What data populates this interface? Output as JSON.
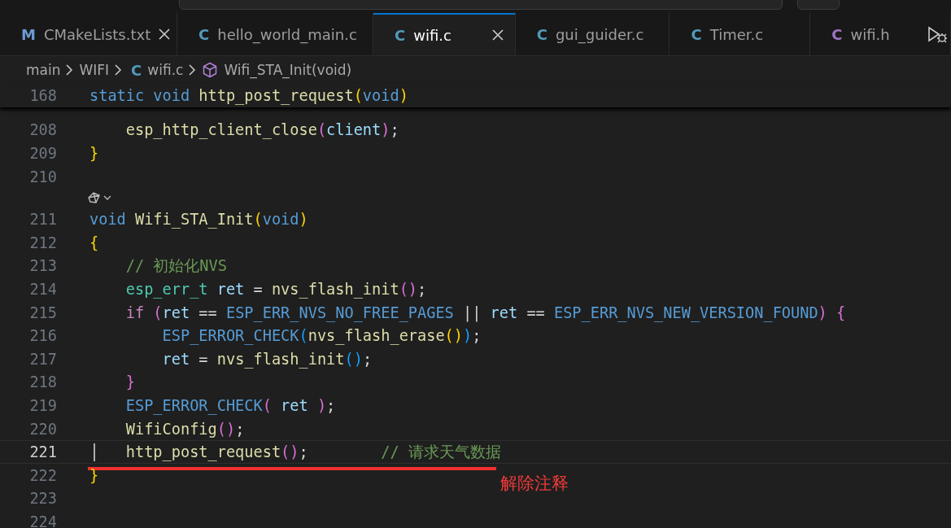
{
  "tabs": [
    {
      "icon": "M",
      "color": "#6c9bd2",
      "label": "CMakeLists.txt",
      "selected": false,
      "closable": true
    },
    {
      "icon": "C",
      "color": "#519aba",
      "label": "hello_world_main.c",
      "selected": false,
      "closable": false
    },
    {
      "icon": "C",
      "color": "#519aba",
      "label": "wifi.c",
      "selected": true,
      "closable": true
    },
    {
      "icon": "C",
      "color": "#519aba",
      "label": "gui_guider.c",
      "selected": false,
      "closable": false
    },
    {
      "icon": "C",
      "color": "#519aba",
      "label": "Timer.c",
      "selected": false,
      "closable": false
    },
    {
      "icon": "C",
      "color": "#a074c4",
      "label": "wifi.h",
      "selected": false,
      "closable": false
    }
  ],
  "breadcrumb": [
    {
      "kind": "folder",
      "label": "main"
    },
    {
      "kind": "folder",
      "label": "WIFI"
    },
    {
      "kind": "file",
      "icon": "C",
      "label": "wifi.c"
    },
    {
      "kind": "symbol",
      "label": "Wifi_STA_Init(void)"
    }
  ],
  "sticky_line": {
    "number": "168",
    "tokens": [
      {
        "color": "#569cd6",
        "t": "static void"
      },
      {
        "color": "#dcdcaa",
        "t": " http_post_request"
      },
      {
        "color": "#ffd700",
        "t": "("
      },
      {
        "color": "#569cd6",
        "t": "void"
      },
      {
        "color": "#ffd700",
        "t": ")"
      }
    ]
  },
  "lines": [
    {
      "kind": "code",
      "number": "208",
      "current": false,
      "tokens": [
        {
          "color": "#dcdcaa",
          "t": "    esp_http_client_close"
        },
        {
          "color": "#da70d6",
          "t": "("
        },
        {
          "color": "#9cdcfe",
          "t": "client"
        },
        {
          "color": "#da70d6",
          "t": ")"
        },
        {
          "color": "#d4d4d4",
          "t": ";"
        }
      ]
    },
    {
      "kind": "code",
      "number": "209",
      "current": false,
      "tokens": [
        {
          "color": "#ffd700",
          "t": "}"
        }
      ]
    },
    {
      "kind": "code",
      "number": "210",
      "current": false
    },
    {
      "kind": "lens"
    },
    {
      "kind": "code",
      "number": "211",
      "current": false,
      "tokens": [
        {
          "color": "#569cd6",
          "t": "void"
        },
        {
          "color": "#dcdcaa",
          "t": " Wifi_STA_Init"
        },
        {
          "color": "#ffd700",
          "t": "("
        },
        {
          "color": "#569cd6",
          "t": "void"
        },
        {
          "color": "#ffd700",
          "t": ")"
        }
      ]
    },
    {
      "kind": "code",
      "number": "212",
      "current": false,
      "tokens": [
        {
          "color": "#ffd700",
          "t": "{"
        }
      ]
    },
    {
      "kind": "code",
      "number": "213",
      "current": false,
      "tokens": [
        {
          "color": "#6a9955",
          "t": "    // 初始化NVS"
        }
      ]
    },
    {
      "kind": "code",
      "number": "214",
      "current": false,
      "tokens": [
        {
          "color": "#4ec9b0",
          "t": "    esp_err_t"
        },
        {
          "color": "#9cdcfe",
          "t": " ret"
        },
        {
          "color": "#d4d4d4",
          "t": " = "
        },
        {
          "color": "#dcdcaa",
          "t": "nvs_flash_init"
        },
        {
          "color": "#da70d6",
          "t": "()"
        },
        {
          "color": "#d4d4d4",
          "t": ";"
        }
      ]
    },
    {
      "kind": "code",
      "number": "215",
      "current": false,
      "tokens": [
        {
          "color": "#c586c0",
          "t": "    if"
        },
        {
          "color": "#da70d6",
          "t": " ("
        },
        {
          "color": "#9cdcfe",
          "t": "ret"
        },
        {
          "color": "#d4d4d4",
          "t": " == "
        },
        {
          "color": "#569cd6",
          "t": "ESP_ERR_NVS_NO_FREE_PAGES"
        },
        {
          "color": "#d4d4d4",
          "t": " || "
        },
        {
          "color": "#9cdcfe",
          "t": "ret"
        },
        {
          "color": "#d4d4d4",
          "t": " == "
        },
        {
          "color": "#569cd6",
          "t": "ESP_ERR_NVS_NEW_VERSION_FOUND"
        },
        {
          "color": "#da70d6",
          "t": ") {"
        }
      ]
    },
    {
      "kind": "code",
      "number": "216",
      "current": false,
      "tokens": [
        {
          "color": "#569cd6",
          "t": "        ESP_ERROR_CHECK"
        },
        {
          "color": "#179fff",
          "t": "("
        },
        {
          "color": "#dcdcaa",
          "t": "nvs_flash_erase"
        },
        {
          "color": "#ffd700",
          "t": "()"
        },
        {
          "color": "#179fff",
          "t": ")"
        },
        {
          "color": "#d4d4d4",
          "t": ";"
        }
      ]
    },
    {
      "kind": "code",
      "number": "217",
      "current": false,
      "tokens": [
        {
          "color": "#9cdcfe",
          "t": "        ret"
        },
        {
          "color": "#d4d4d4",
          "t": " = "
        },
        {
          "color": "#dcdcaa",
          "t": "nvs_flash_init"
        },
        {
          "color": "#179fff",
          "t": "()"
        },
        {
          "color": "#d4d4d4",
          "t": ";"
        }
      ]
    },
    {
      "kind": "code",
      "number": "218",
      "current": false,
      "tokens": [
        {
          "color": "#da70d6",
          "t": "    }"
        }
      ]
    },
    {
      "kind": "code",
      "number": "219",
      "current": false,
      "tokens": [
        {
          "color": "#569cd6",
          "t": "    ESP_ERROR_CHECK"
        },
        {
          "color": "#da70d6",
          "t": "("
        },
        {
          "color": "#9cdcfe",
          "t": " ret"
        },
        {
          "color": "#da70d6",
          "t": " )"
        },
        {
          "color": "#d4d4d4",
          "t": ";"
        }
      ]
    },
    {
      "kind": "code",
      "number": "220",
      "current": false,
      "tokens": [
        {
          "color": "#dcdcaa",
          "t": "    WifiConfig"
        },
        {
          "color": "#da70d6",
          "t": "()"
        },
        {
          "color": "#d4d4d4",
          "t": ";"
        }
      ]
    },
    {
      "kind": "code",
      "number": "221",
      "current": true,
      "tokens": [
        {
          "color": "#dcdcaa",
          "t": "    http_post_request"
        },
        {
          "color": "#da70d6",
          "t": "()"
        },
        {
          "color": "#d4d4d4",
          "t": ";        "
        },
        {
          "color": "#6a9955",
          "t": "// 请求天气数据"
        }
      ]
    },
    {
      "kind": "code",
      "number": "222",
      "current": false,
      "tokens": [
        {
          "color": "#ffd700",
          "t": "}"
        }
      ]
    },
    {
      "kind": "code",
      "number": "223",
      "current": false
    },
    {
      "kind": "code",
      "number": "224",
      "current": false
    }
  ],
  "annotation": {
    "text": "解除注释"
  }
}
